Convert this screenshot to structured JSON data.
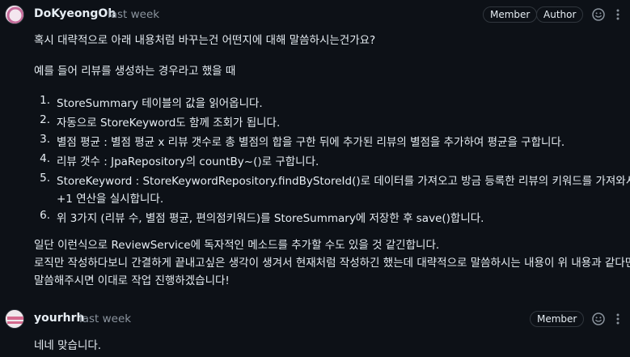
{
  "comments": [
    {
      "author": "DoKyeongOh",
      "time": "last week",
      "badges": [
        "Member",
        "Author"
      ],
      "paragraphs": [
        "혹시 대략적으로 아래 내용처럼 바꾸는건 어떤지에 대해 말씀하시는건가요?",
        "예를 들어 리뷰를 생성하는 경우라고 했을 때"
      ],
      "list": [
        "StoreSummary 테이블의 값을 읽어옵니다.",
        "자동으로 StoreKeyword도 함께 조회가 됩니다.",
        "별점 평균 : 별점 평균 x 리뷰 갯수로 총 별점의 합을 구한 뒤에 추가된 리뷰의 별점을 추가하여 평균을 구합니다.",
        "리뷰 갯수 : JpaRepository의 countBy~()로 구합니다.",
        "StoreKeyword : StoreKeywordRepository.findByStoreId()로 데이터를 가져오고 방금 등록한 리뷰의 키워드를 가져와서",
        "+1 연산을 실시합니다.",
        "위 3가지 (리뷰 수, 별점 평균, 편의점키워드)를 StoreSummary에 저장한 후 save()합니다."
      ],
      "closing": [
        "일단 이런식으로 ReviewService에 독자적인 메소드를 추가할 수도 있을 것 같긴합니다.",
        "로직만 작성하다보니 간결하게 끝내고싶은 생각이 생겨서 현재처럼 작성하긴 했는데 대략적으로 말씀하시는 내용이 위 내용과 같다면",
        "말씀해주시면 이대로 작업 진행하겠습니다!"
      ]
    },
    {
      "author": "yourhrh",
      "time": "last week",
      "badges": [
        "Member"
      ],
      "paragraphs": [
        "네네 맞습니다."
      ]
    }
  ],
  "icons": {
    "emoji": "smiley-icon",
    "menu": "kebab-icon"
  },
  "colors": {
    "background": "#0d1117",
    "text": "#e6edf3",
    "muted": "#8b949e",
    "border": "#30363d"
  }
}
